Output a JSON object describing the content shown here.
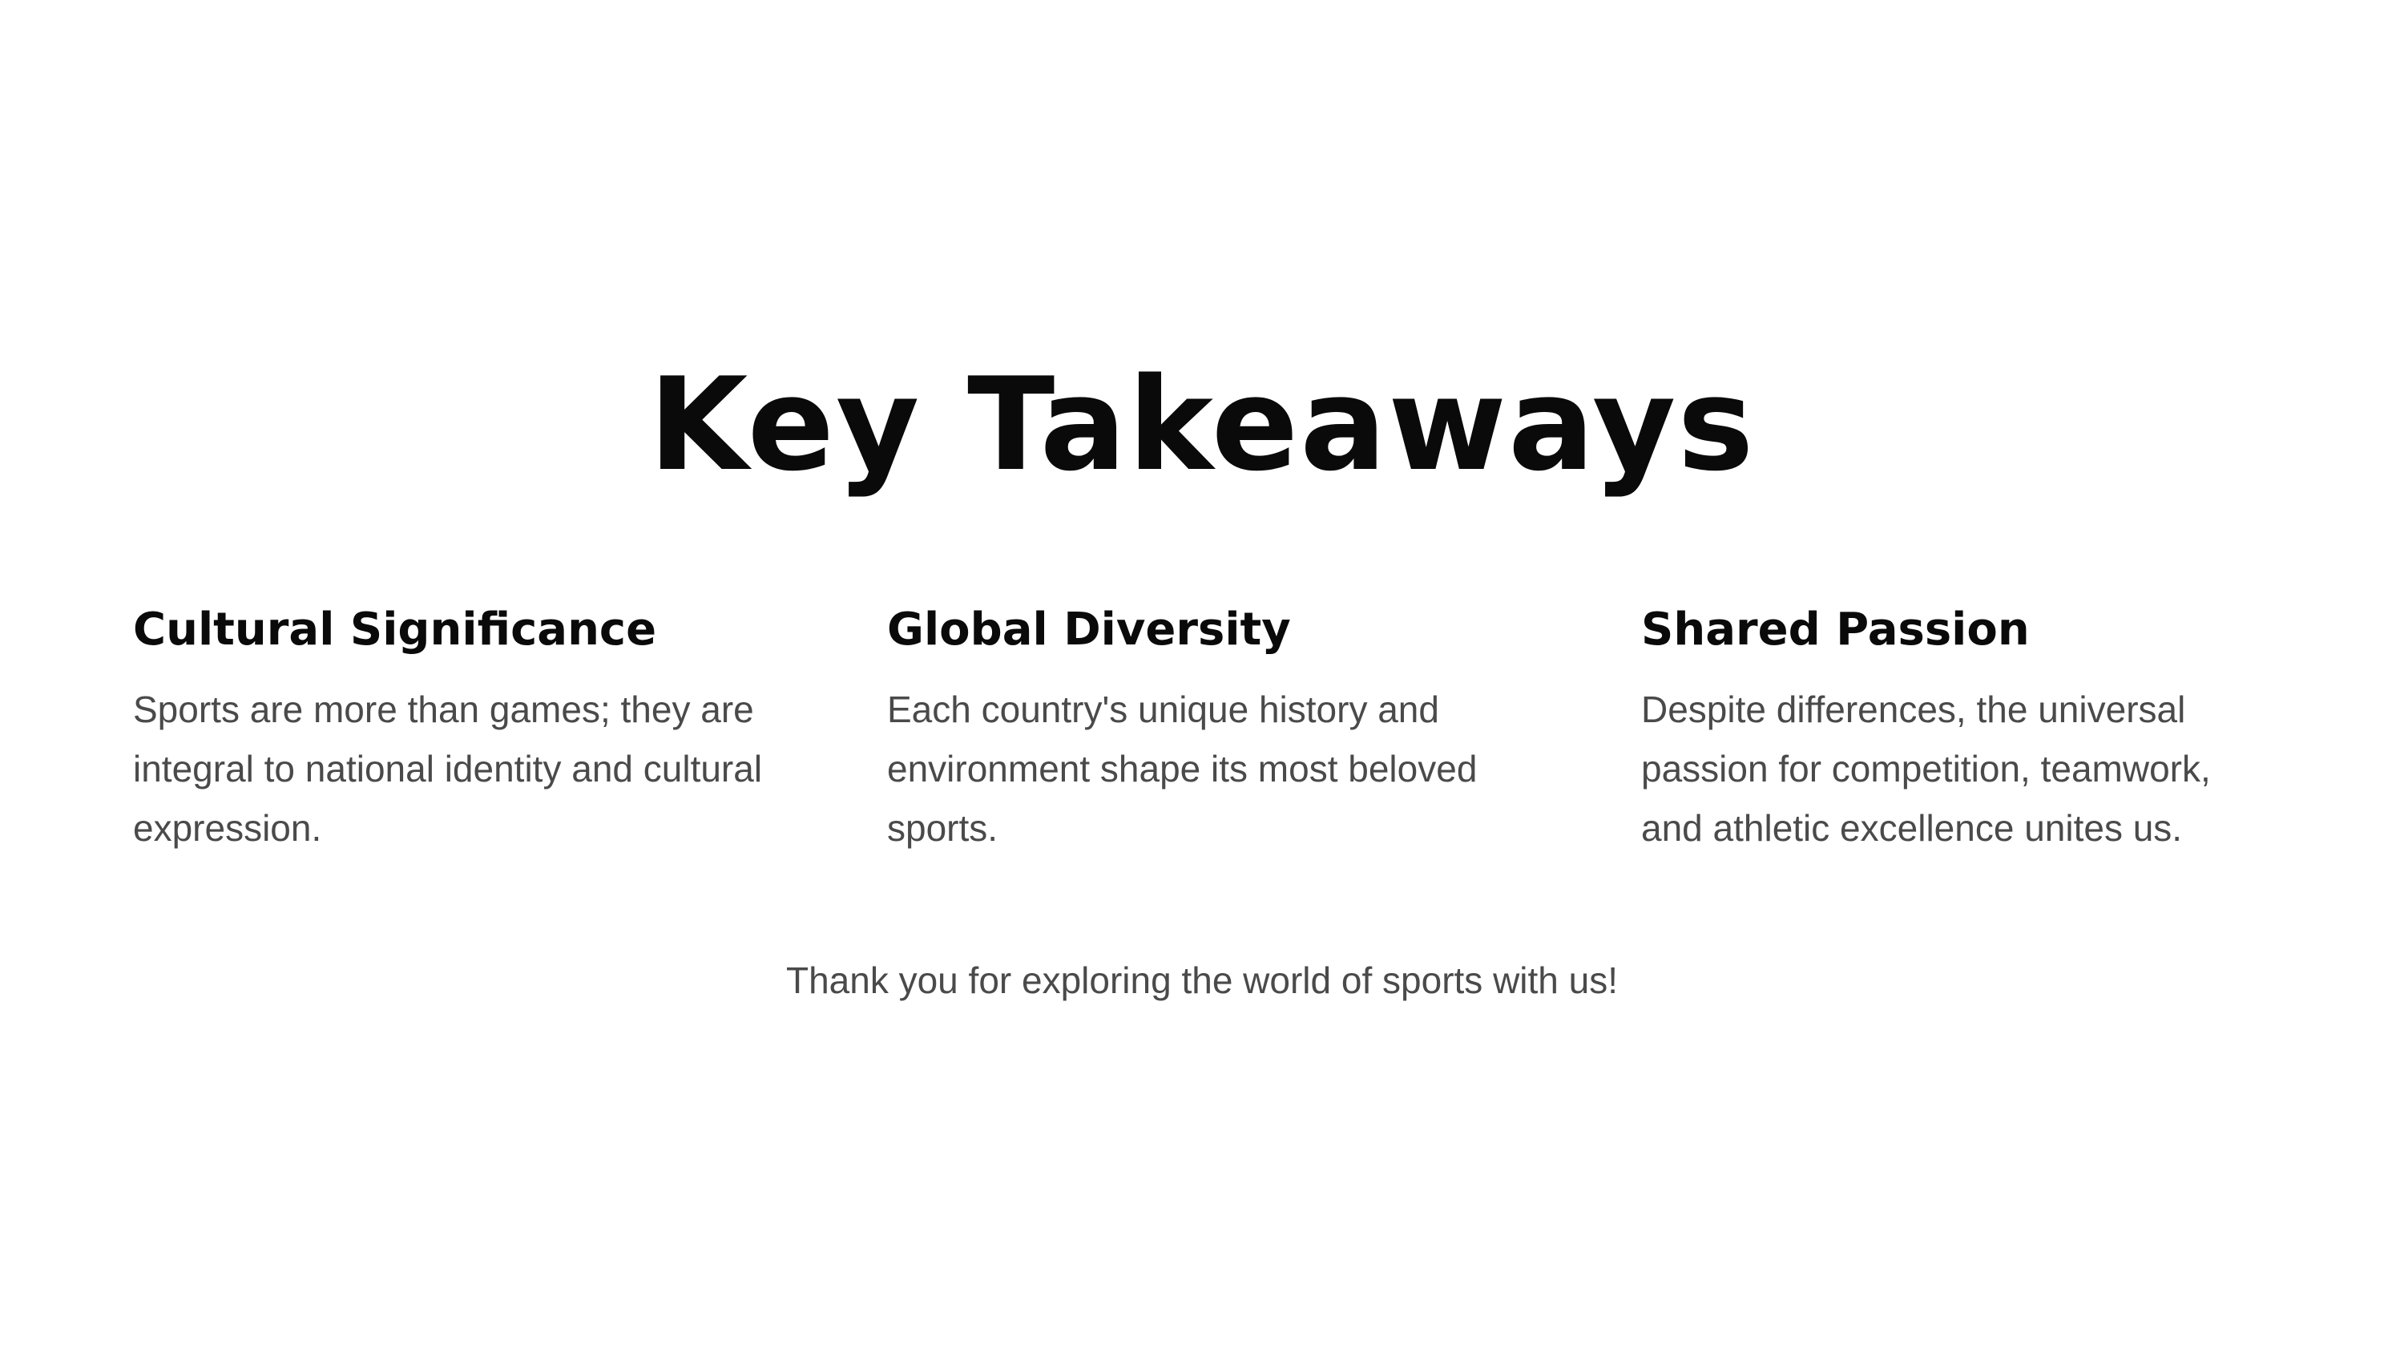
{
  "slide": {
    "title": "Key Takeaways",
    "columns": [
      {
        "heading": "Cultural Significance",
        "body": "Sports are more than games; they are integral to national identity and cultural expression."
      },
      {
        "heading": "Global Diversity",
        "body": "Each country's unique history and environment shape its most beloved sports."
      },
      {
        "heading": "Shared Passion",
        "body": "Despite differences, the universal passion for competition, teamwork, and athletic excellence unites us."
      }
    ],
    "closing": "Thank you for exploring the world of sports with us!"
  },
  "colors": {
    "background": "#ffffff",
    "heading": "#0a0a0a",
    "body": "#4a4a4a"
  }
}
